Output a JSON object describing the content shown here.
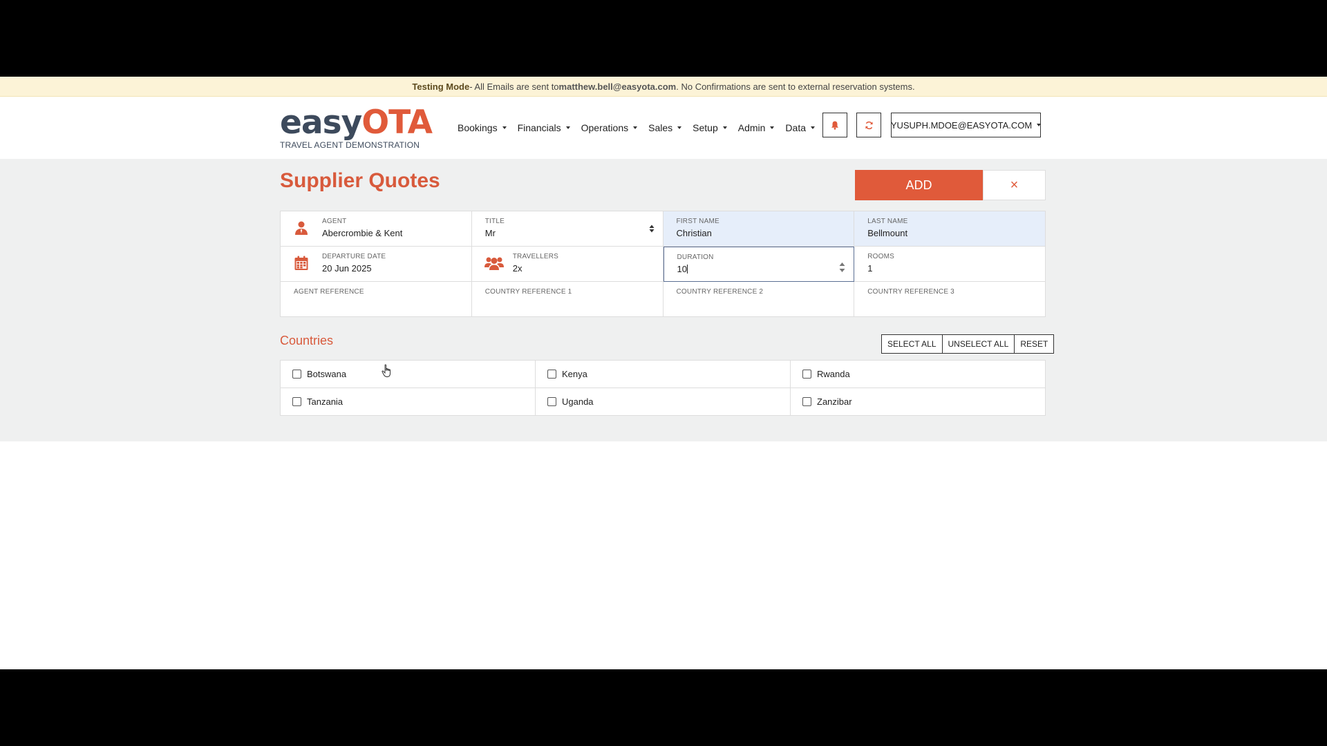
{
  "banner": {
    "mode": "Testing Mode",
    "pre": " - All Emails are sent to ",
    "email": "matthew.bell@easyota.com",
    "post": ". No Confirmations are sent to external reservation systems."
  },
  "logo": {
    "easy": "easy",
    "ota": "OTA",
    "subtitle": "TRAVEL AGENT DEMONSTRATION"
  },
  "nav": [
    "Bookings",
    "Financials",
    "Operations",
    "Sales",
    "Setup",
    "Admin",
    "Data"
  ],
  "user": {
    "email": "YUSUPH.MDOE@EASYOTA.COM"
  },
  "page": {
    "title": "Supplier Quotes",
    "add_label": "ADD",
    "close_label": "×"
  },
  "form": {
    "agent": {
      "label": "AGENT",
      "value": "Abercrombie & Kent"
    },
    "title": {
      "label": "TITLE",
      "value": "Mr"
    },
    "first_name": {
      "label": "FIRST NAME",
      "value": "Christian"
    },
    "last_name": {
      "label": "LAST NAME",
      "value": "Bellmount"
    },
    "departure_date": {
      "label": "DEPARTURE DATE",
      "value": "20 Jun 2025"
    },
    "travellers": {
      "label": "TRAVELLERS",
      "value": "2x"
    },
    "duration": {
      "label": "DURATION",
      "value": "10"
    },
    "rooms": {
      "label": "ROOMS",
      "value": "1"
    },
    "agent_reference": {
      "label": "AGENT REFERENCE",
      "value": ""
    },
    "country_ref_1": {
      "label": "COUNTRY REFERENCE 1",
      "value": ""
    },
    "country_ref_2": {
      "label": "COUNTRY REFERENCE 2",
      "value": ""
    },
    "country_ref_3": {
      "label": "COUNTRY REFERENCE 3",
      "value": ""
    }
  },
  "countries": {
    "title": "Countries",
    "select_all": "SELECT ALL",
    "unselect_all": "UNSELECT ALL",
    "reset": "RESET",
    "items": [
      "Botswana",
      "Kenya",
      "Rwanda",
      "Tanzania",
      "Uganda",
      "Zanzibar"
    ]
  },
  "colors": {
    "accent": "#e05a3a",
    "highlight": "#e6eefa",
    "banner": "#fcf3d7"
  }
}
